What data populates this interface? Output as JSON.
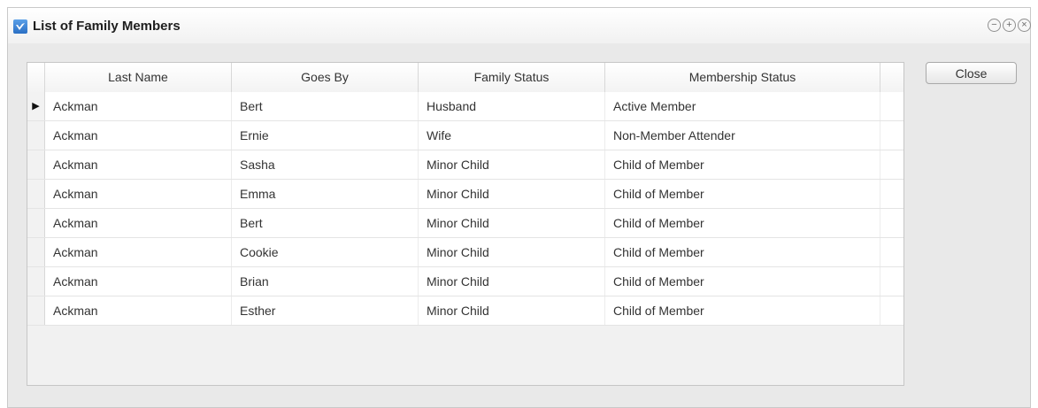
{
  "window": {
    "title": "List of Family Members",
    "controls": {
      "minimize": "−",
      "maximize": "+",
      "close": "×"
    }
  },
  "table": {
    "columns": [
      "Last Name",
      "Goes By",
      "Family Status",
      "Membership Status"
    ],
    "rows": [
      {
        "selected": true,
        "last_name": "Ackman",
        "goes_by": "Bert",
        "family_status": "Husband",
        "membership_status": "Active Member"
      },
      {
        "selected": false,
        "last_name": "Ackman",
        "goes_by": "Ernie",
        "family_status": "Wife",
        "membership_status": "Non-Member Attender"
      },
      {
        "selected": false,
        "last_name": "Ackman",
        "goes_by": "Sasha",
        "family_status": "Minor Child",
        "membership_status": "Child of Member"
      },
      {
        "selected": false,
        "last_name": "Ackman",
        "goes_by": "Emma",
        "family_status": "Minor Child",
        "membership_status": "Child of Member"
      },
      {
        "selected": false,
        "last_name": "Ackman",
        "goes_by": "Bert",
        "family_status": "Minor Child",
        "membership_status": "Child of Member"
      },
      {
        "selected": false,
        "last_name": "Ackman",
        "goes_by": "Cookie",
        "family_status": "Minor Child",
        "membership_status": "Child of Member"
      },
      {
        "selected": false,
        "last_name": "Ackman",
        "goes_by": "Brian",
        "family_status": "Minor Child",
        "membership_status": "Child of Member"
      },
      {
        "selected": false,
        "last_name": "Ackman",
        "goes_by": "Esther",
        "family_status": "Minor Child",
        "membership_status": "Child of Member"
      }
    ],
    "current_row_marker": "▶"
  },
  "buttons": {
    "close_label": "Close"
  },
  "icons": {
    "app": "family-app-icon",
    "minimize": "minimize-icon",
    "maximize": "maximize-icon",
    "close": "close-icon",
    "row_pointer": "current-row-pointer-icon"
  },
  "colors": {
    "accent": "#2a6fc4",
    "row_bg": "#ffffff",
    "header_bg": "#f3f3f3"
  }
}
